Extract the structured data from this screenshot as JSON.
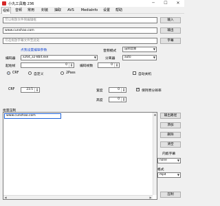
{
  "window": {
    "title": "小丸工具箱 236",
    "minimize": "─",
    "maximize": "☐",
    "close": "✕"
  },
  "menu": [
    "视频",
    "音频",
    "常用",
    "封装",
    "抽取",
    "AVS",
    "MediaInfo",
    "设置",
    "帮助"
  ],
  "video_tab": {
    "input_placeholder": "可以拖放文件到编辑框",
    "input_button": "输入",
    "output_value": "www.cunshao.com",
    "output_button": "输出",
    "subtitle_placeholder": "可选拖放字幕文件至此处",
    "subtitle_button": "字幕",
    "settings_link": "点我设置编辑参数",
    "audio_mode_label": "音频模式",
    "audio_mode_value": "压制音频",
    "encoder_label": "编码器",
    "encoder_value": "x264_32-8bit.exe",
    "splitter_label": "分离器",
    "splitter_value": "auto",
    "start_frame_label": "起始帧",
    "start_frame_value": "0",
    "encode_frames_label": "编码帧数",
    "encode_frames_value": "0",
    "crf_option": "CRF",
    "custom_option": "自定义",
    "twopass_option": "2Pass",
    "auto_shutdown_label": "自动关机",
    "crf_label": "CRF",
    "crf_value": "23.5",
    "width_label": "宽度",
    "width_value": "0",
    "height_label": "高度",
    "height_value": "0",
    "keep_resolution_label": "保持原分辨率"
  },
  "batch": {
    "label": "批量压制",
    "list_item": "www.cunshao.com",
    "output_path_button": "输出路径",
    "add_button": "添加",
    "delete_button": "删除",
    "clear_button": "清空",
    "embedded_subs_label": "内嵌字幕",
    "embedded_subs_value": "none",
    "format_label": "格式",
    "format_value": "mp4",
    "compress_button": "压制"
  }
}
